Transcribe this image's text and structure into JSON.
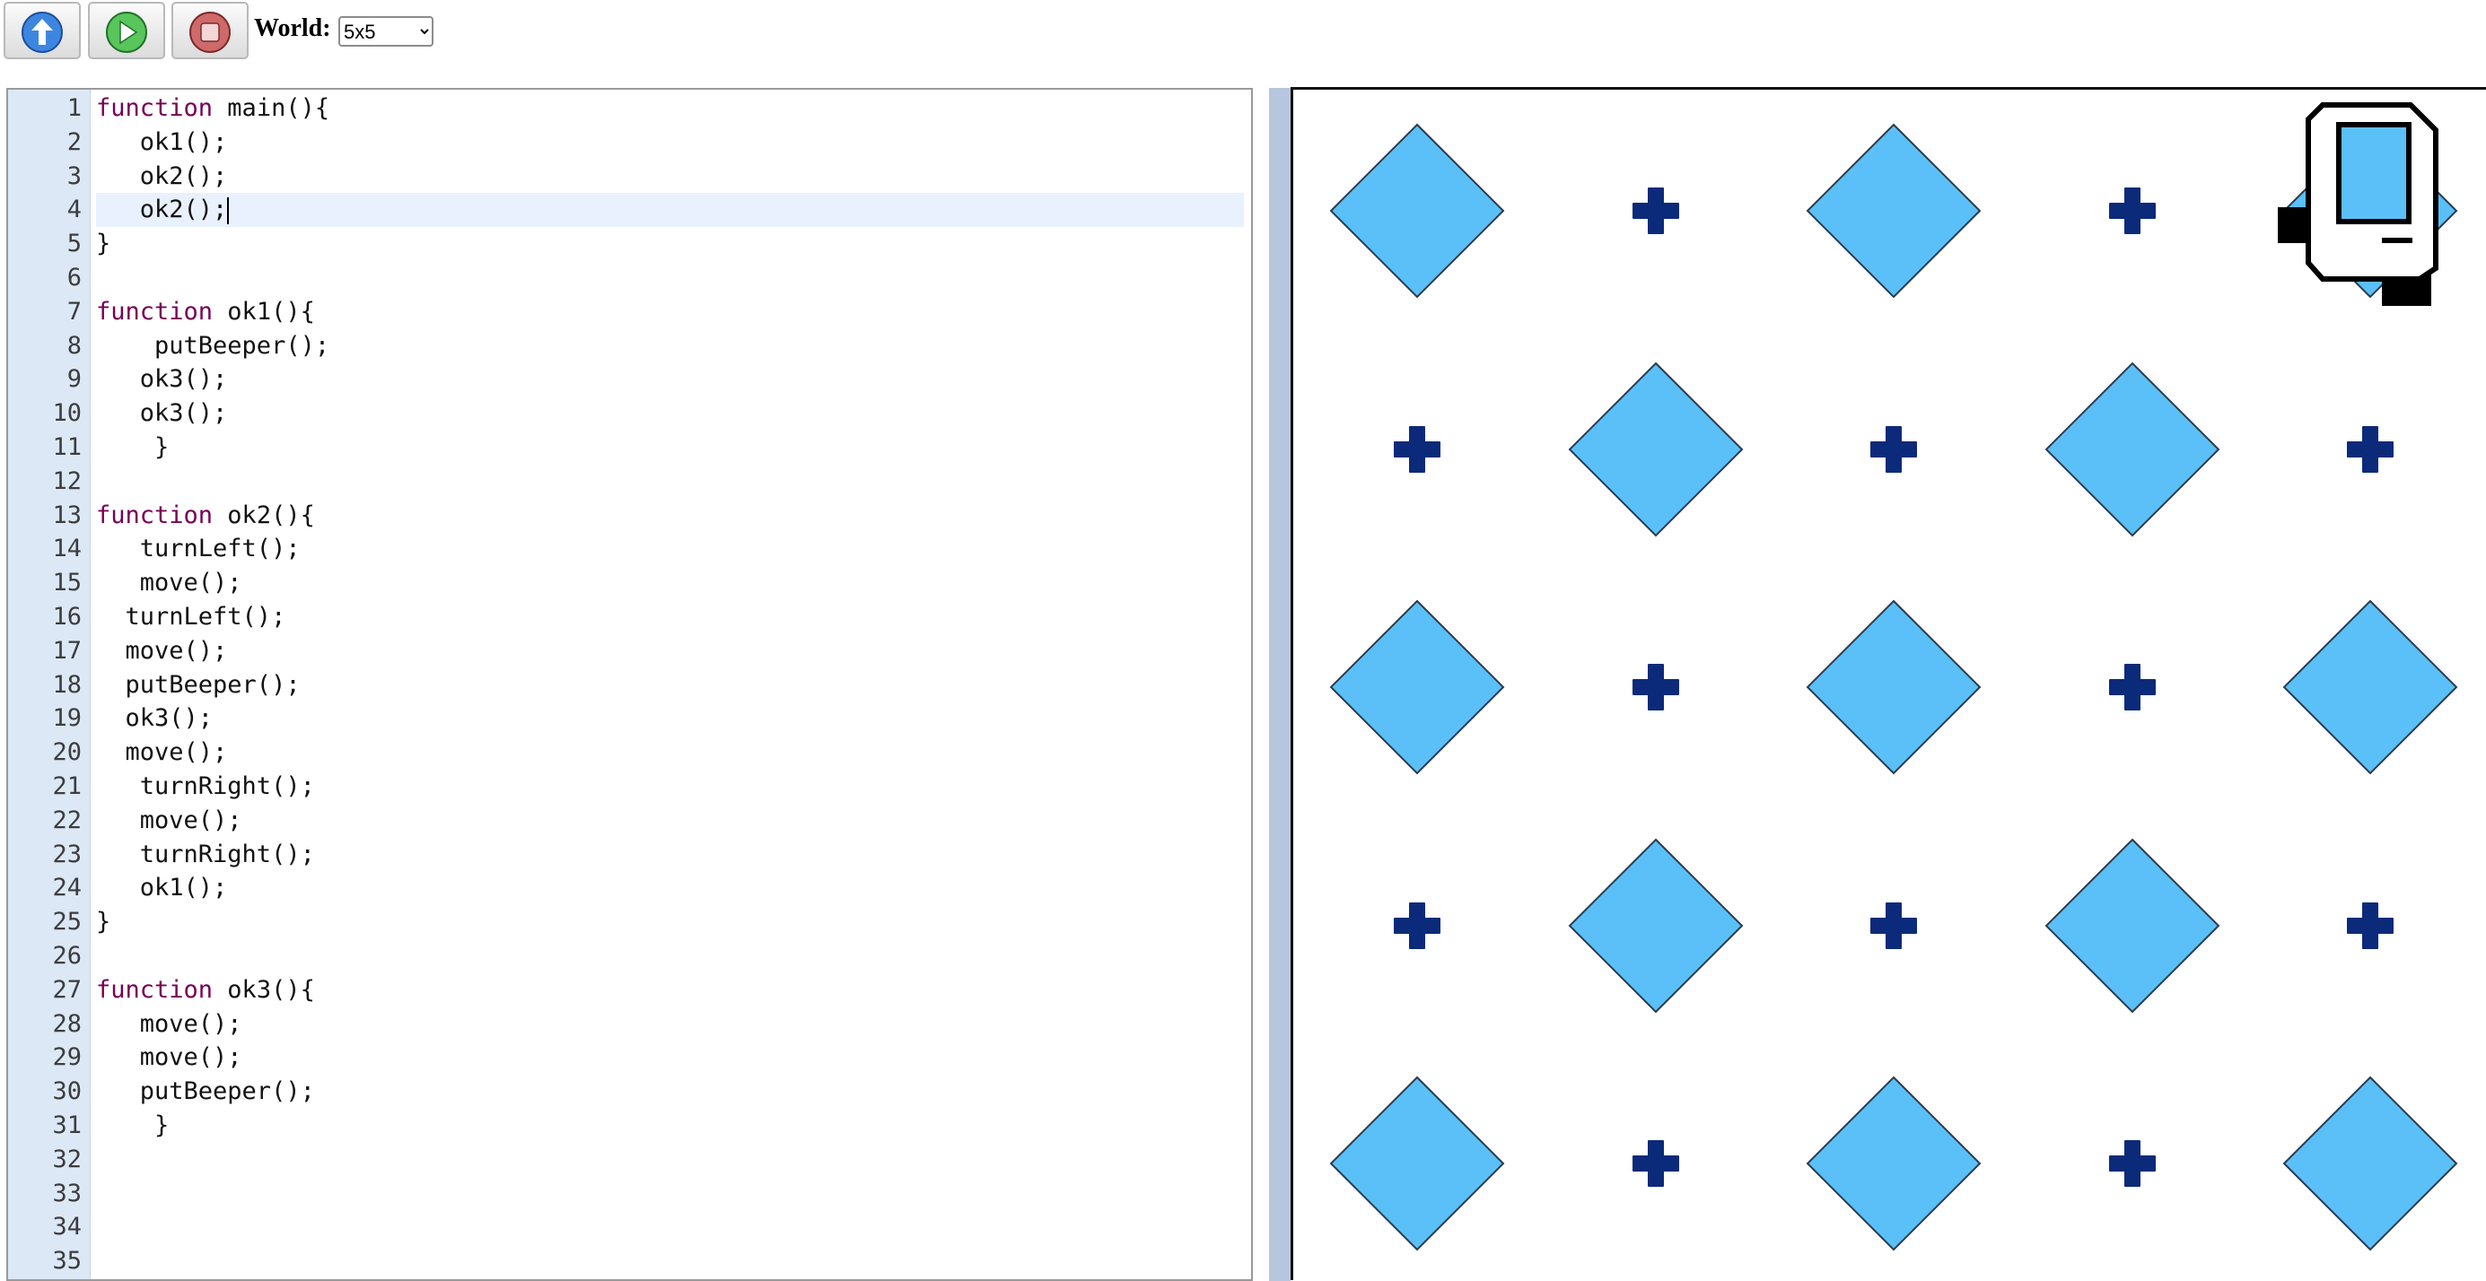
{
  "toolbar": {
    "buttons": [
      {
        "name": "upload-button",
        "icon": "up-arrow-icon"
      },
      {
        "name": "run-button",
        "icon": "play-icon"
      },
      {
        "name": "stop-button",
        "icon": "stop-icon"
      }
    ],
    "world_label": "World:",
    "world_value": "5x5",
    "world_options": [
      "5x5"
    ]
  },
  "editor": {
    "active_line": 4,
    "lines": [
      {
        "n": "1",
        "kw": "function",
        "rest": " main(){"
      },
      {
        "n": "2",
        "kw": "",
        "rest": "   ok1();"
      },
      {
        "n": "3",
        "kw": "",
        "rest": "   ok2();"
      },
      {
        "n": "4",
        "kw": "",
        "rest": "   ok2();"
      },
      {
        "n": "5",
        "kw": "",
        "rest": "}"
      },
      {
        "n": "6",
        "kw": "",
        "rest": ""
      },
      {
        "n": "7",
        "kw": "function",
        "rest": " ok1(){"
      },
      {
        "n": "8",
        "kw": "",
        "rest": "    putBeeper();"
      },
      {
        "n": "9",
        "kw": "",
        "rest": "   ok3();"
      },
      {
        "n": "10",
        "kw": "",
        "rest": "   ok3();"
      },
      {
        "n": "11",
        "kw": "",
        "rest": "    }"
      },
      {
        "n": "12",
        "kw": "",
        "rest": ""
      },
      {
        "n": "13",
        "kw": "function",
        "rest": " ok2(){"
      },
      {
        "n": "14",
        "kw": "",
        "rest": "   turnLeft();"
      },
      {
        "n": "15",
        "kw": "",
        "rest": "   move();"
      },
      {
        "n": "16",
        "kw": "",
        "rest": "  turnLeft();"
      },
      {
        "n": "17",
        "kw": "",
        "rest": "  move();"
      },
      {
        "n": "18",
        "kw": "",
        "rest": "  putBeeper();"
      },
      {
        "n": "19",
        "kw": "",
        "rest": "  ok3();"
      },
      {
        "n": "20",
        "kw": "",
        "rest": "  move();"
      },
      {
        "n": "21",
        "kw": "",
        "rest": "   turnRight();"
      },
      {
        "n": "22",
        "kw": "",
        "rest": "   move();"
      },
      {
        "n": "23",
        "kw": "",
        "rest": "   turnRight();"
      },
      {
        "n": "24",
        "kw": "",
        "rest": "   ok1();"
      },
      {
        "n": "25",
        "kw": "",
        "rest": "}"
      },
      {
        "n": "26",
        "kw": "",
        "rest": ""
      },
      {
        "n": "27",
        "kw": "function",
        "rest": " ok3(){"
      },
      {
        "n": "28",
        "kw": "",
        "rest": "   move();"
      },
      {
        "n": "29",
        "kw": "",
        "rest": "   move();"
      },
      {
        "n": "30",
        "kw": "",
        "rest": "   putBeeper();"
      },
      {
        "n": "31",
        "kw": "",
        "rest": "    }"
      },
      {
        "n": "32",
        "kw": "",
        "rest": ""
      },
      {
        "n": "33",
        "kw": "",
        "rest": ""
      },
      {
        "n": "34",
        "kw": "",
        "rest": ""
      },
      {
        "n": "35",
        "kw": "",
        "rest": ""
      }
    ]
  },
  "world": {
    "rows": 5,
    "cols": 5,
    "grid": [
      [
        "beeper",
        "corner",
        "beeper",
        "corner",
        "beeper"
      ],
      [
        "corner",
        "beeper",
        "corner",
        "beeper",
        "corner"
      ],
      [
        "beeper",
        "corner",
        "beeper",
        "corner",
        "beeper"
      ],
      [
        "corner",
        "beeper",
        "corner",
        "beeper",
        "corner"
      ],
      [
        "beeper",
        "corner",
        "beeper",
        "corner",
        "beeper"
      ]
    ],
    "robot": {
      "row": 1,
      "col": 5,
      "icon": "karel-robot-icon"
    },
    "colors": {
      "beeper": "#5bc0f8",
      "corner": "#0b2a7a",
      "robot_screen": "#5bc0f8"
    }
  }
}
